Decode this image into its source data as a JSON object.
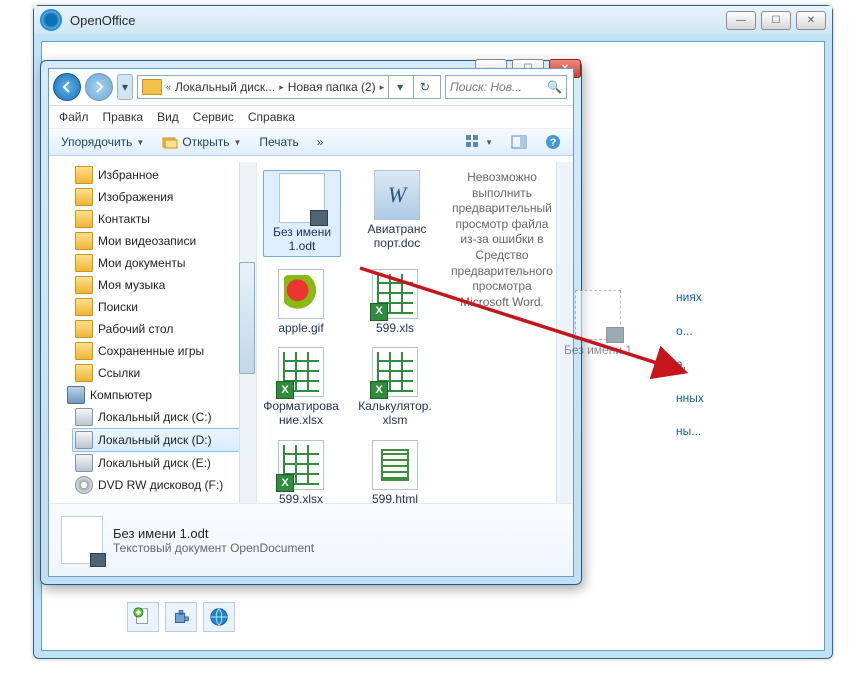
{
  "openoffice": {
    "title": "OpenOffice",
    "side_items": [
      "ниях",
      "о...",
      "a,",
      "нных",
      "ны..."
    ]
  },
  "explorer": {
    "breadcrumb": {
      "seg1": "Локальный диск...",
      "seg2": "Новая папка (2)"
    },
    "search_placeholder": "Поиск: Нов...",
    "menus": {
      "file": "Файл",
      "edit": "Правка",
      "view": "Вид",
      "service": "Сервис",
      "help": "Справка"
    },
    "toolbar": {
      "organize": "Упорядочить",
      "open": "Открыть",
      "print": "Печать",
      "more": "»"
    },
    "tree": [
      {
        "label": "Избранное",
        "icon": "star"
      },
      {
        "label": "Изображения",
        "icon": "folder"
      },
      {
        "label": "Контакты",
        "icon": "folder"
      },
      {
        "label": "Мои видеозаписи",
        "icon": "folder"
      },
      {
        "label": "Мои документы",
        "icon": "folder"
      },
      {
        "label": "Моя музыка",
        "icon": "folder"
      },
      {
        "label": "Поиски",
        "icon": "folder"
      },
      {
        "label": "Рабочий стол",
        "icon": "folder"
      },
      {
        "label": "Сохраненные игры",
        "icon": "folder"
      },
      {
        "label": "Ссылки",
        "icon": "folder"
      },
      {
        "label": "Компьютер",
        "icon": "comp",
        "indent": -8
      },
      {
        "label": "Локальный диск (C:)",
        "icon": "disk"
      },
      {
        "label": "Локальный диск (D:)",
        "icon": "disk",
        "selected": true
      },
      {
        "label": "Локальный диск (E:)",
        "icon": "disk"
      },
      {
        "label": "DVD RW дисковод (F:)",
        "icon": "dvd"
      }
    ],
    "files": [
      {
        "name": "Без имени 1.odt",
        "thumb": "doc",
        "selected": true
      },
      {
        "name": "Авиатранс порт.doc",
        "thumb": "docw"
      },
      {
        "name": "apple.gif",
        "thumb": "img"
      },
      {
        "name": "599.xls",
        "thumb": "xls"
      },
      {
        "name": "Форматирование.xlsx",
        "thumb": "xls"
      },
      {
        "name": "Калькулятор.xlsm",
        "thumb": "xls"
      },
      {
        "name": "599.xlsx",
        "thumb": "xls"
      },
      {
        "name": "599.html",
        "thumb": "html"
      }
    ],
    "preview_text": "Невозможно выполнить предварительный просмотр файла из-за ошибки в Средство предварительного просмотра Microsoft Word.",
    "details": {
      "name": "Без имени 1.odt",
      "type": "Текстовый документ OpenDocument"
    }
  },
  "ghost_label": "Без имени 1"
}
